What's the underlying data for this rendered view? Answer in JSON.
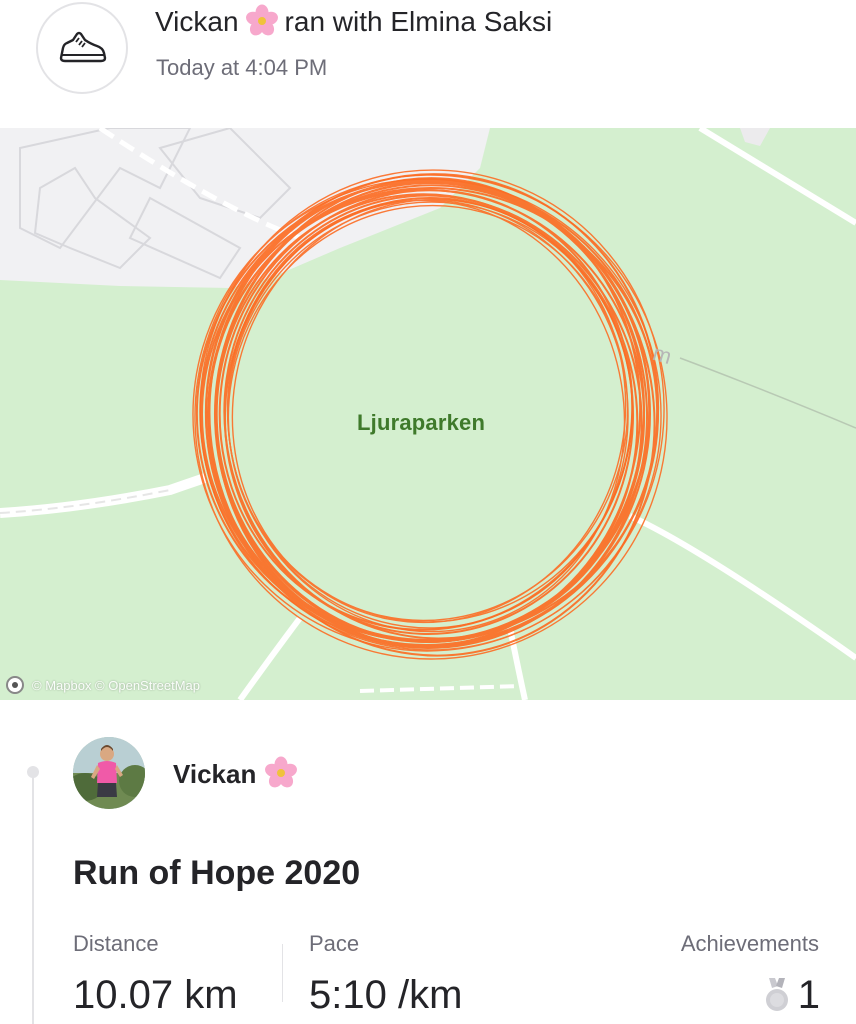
{
  "header": {
    "athlete": "Vickan",
    "emoji": "cherry-blossom",
    "with_text": "ran with Elmina Saksi",
    "time": "Today at 4:04 PM",
    "activity_icon": "running-shoe-icon"
  },
  "map": {
    "place_label": "Ljuraparken",
    "elevation_label": "m",
    "credit": "© Mapbox © OpenStreetMap",
    "route_color": "#fc6d24",
    "park_color": "#d4efcf",
    "building_color": "#f1f1f3"
  },
  "athlete": {
    "name": "Vickan",
    "emoji": "cherry-blossom"
  },
  "activity": {
    "title": "Run of Hope 2020"
  },
  "stats": {
    "distance_label": "Distance",
    "distance_value": "10.07 km",
    "pace_label": "Pace",
    "pace_value": "5:10 /km",
    "achievements_label": "Achievements",
    "achievements_value": "1",
    "achievements_icon": "medal-icon"
  }
}
